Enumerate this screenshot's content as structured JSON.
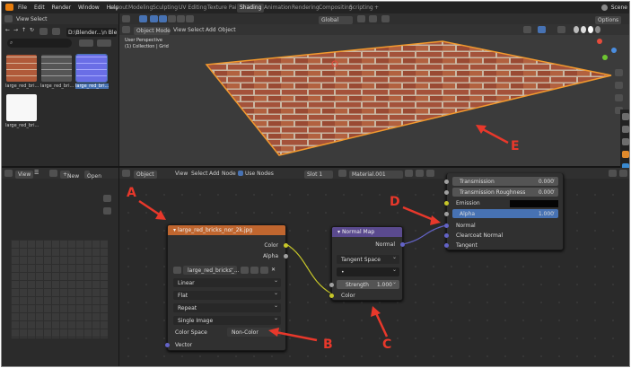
{
  "topbar": {
    "menus": [
      "File",
      "Edit",
      "Render",
      "Window",
      "Help"
    ],
    "workspaces": [
      "Layout",
      "Modeling",
      "Sculpting",
      "UV Editing",
      "Texture Paint",
      "Shading",
      "Animation",
      "Rendering",
      "Compositing",
      "Scripting"
    ],
    "active_workspace": "Shading",
    "scene": "Scene"
  },
  "filebrowser": {
    "header": [
      "View",
      "Select"
    ],
    "path": "D:\\Blender...\\n Blender\\",
    "thumbnails": [
      "large_red_bri...",
      "large_red_bri...",
      "large_red_bri...",
      "large_red_bri..."
    ]
  },
  "viewport": {
    "mode": "Object Mode",
    "menus": [
      "View",
      "Select",
      "Add",
      "Object"
    ],
    "transform": "Global",
    "options": "Options",
    "info_line1": "User Perspective",
    "info_line2": "(1) Collection | Grid"
  },
  "imageeditor": {
    "menu": "View",
    "new": "New",
    "open": "Open"
  },
  "nodeeditor": {
    "object": "Object",
    "menus": [
      "View",
      "Select",
      "Add",
      "Node"
    ],
    "use_nodes": "Use Nodes",
    "slot": "Slot 1",
    "material": "Material.001"
  },
  "image_node": {
    "title": "large_red_bricks_nor_2k.jpg",
    "out_color": "Color",
    "out_alpha": "Alpha",
    "image_name": "large_red_bricks_...",
    "interpolation": "Linear",
    "projection": "Flat",
    "extension": "Repeat",
    "source": "Single Image",
    "color_space_label": "Color Space",
    "color_space": "Non-Color",
    "in_vector": "Vector"
  },
  "normal_node": {
    "title": "Normal Map",
    "out_normal": "Normal",
    "space": "Tangent Space",
    "uv_placeholder": "•",
    "strength_label": "Strength",
    "strength_value": "1.000",
    "in_color": "Color"
  },
  "bsdf_node": {
    "transmission_label": "Transmission",
    "transmission_value": "0.000",
    "roughness_label": "Transmission Roughness",
    "roughness_value": "0.000",
    "emission": "Emission",
    "alpha_label": "Alpha",
    "alpha_value": "1.000",
    "normal": "Normal",
    "clearcoat_normal": "Clearcoat Normal",
    "tangent": "Tangent"
  },
  "annotations": {
    "a": "A",
    "b": "B",
    "c": "C",
    "d": "D",
    "e": "E"
  },
  "colors": {
    "annotation": "#e8382b",
    "accent": "#4772b3",
    "image_header": "#c0662f",
    "normal_header": "#5a4a8e"
  }
}
